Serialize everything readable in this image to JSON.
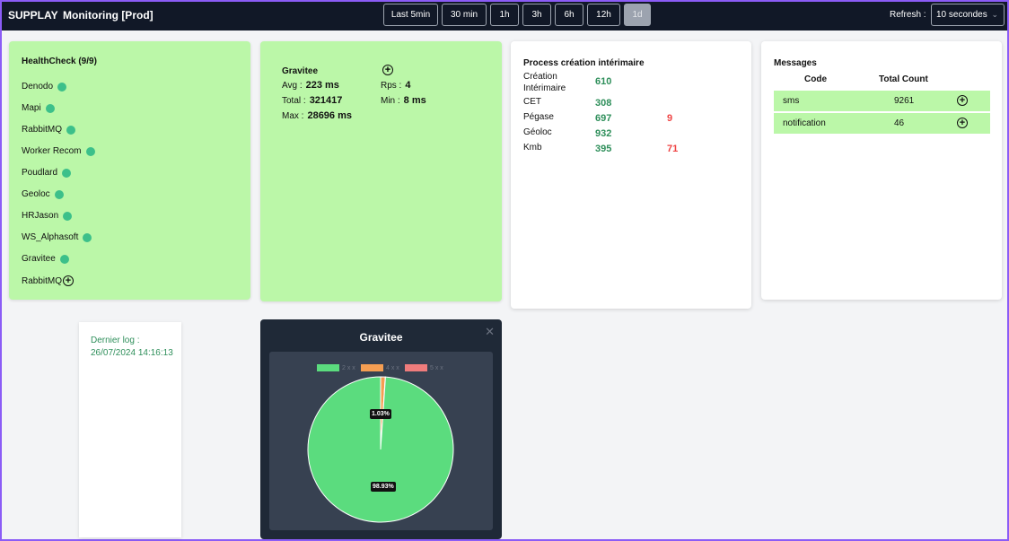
{
  "header": {
    "brand": "SUPPLAY",
    "title": "Monitoring [Prod]",
    "ranges": [
      "Last 5min",
      "30 min",
      "1h",
      "3h",
      "6h",
      "12h",
      "1d"
    ],
    "active_range": "1d",
    "refresh_label": "Refresh :",
    "refresh_value": "10 secondes"
  },
  "healthcheck": {
    "title": "HealthCheck (9/9)",
    "items": [
      {
        "name": "Denodo",
        "status": "up"
      },
      {
        "name": "Mapi",
        "status": "up"
      },
      {
        "name": "RabbitMQ",
        "status": "up"
      },
      {
        "name": "Worker Recom",
        "status": "up"
      },
      {
        "name": "Poudlard",
        "status": "up"
      },
      {
        "name": "Geoloc",
        "status": "up"
      },
      {
        "name": "HRJason",
        "status": "up"
      },
      {
        "name": "WS_Alphasoft",
        "status": "up"
      },
      {
        "name": "Gravitee",
        "status": "up"
      },
      {
        "name": "RabbitMQ",
        "status": "expand"
      }
    ],
    "status_color": "#3cc08a"
  },
  "gravitee_stats": {
    "title": "Gravitee",
    "avg_label": "Avg :",
    "avg": "223 ms",
    "total_label": "Total :",
    "total": "321417",
    "max_label": "Max :",
    "max": "28696 ms",
    "rps_label": "Rps :",
    "rps": "4",
    "min_label": "Min :",
    "min": "8 ms"
  },
  "process": {
    "title": "Process création intérimaire",
    "rows": [
      {
        "label": "Création Intérimaire",
        "value": "610",
        "errors": ""
      },
      {
        "label": "CET",
        "value": "308",
        "errors": ""
      },
      {
        "label": "Pégase",
        "value": "697",
        "errors": "9"
      },
      {
        "label": "Géoloc",
        "value": "932",
        "errors": ""
      },
      {
        "label": "Kmb",
        "value": "395",
        "errors": "71"
      }
    ]
  },
  "messages": {
    "title": "Messages",
    "col_code": "Code",
    "col_count": "Total Count",
    "rows": [
      {
        "code": "sms",
        "count": "9261"
      },
      {
        "code": "notification",
        "count": "46"
      }
    ]
  },
  "last_log": {
    "label": "Dernier log :",
    "timestamp": "26/07/2024 14:16:13"
  },
  "pie_panel": {
    "title": "Gravitee",
    "close_icon": "close-icon",
    "chart_data": {
      "type": "pie",
      "title": "Gravitee",
      "series": [
        {
          "name": "2 x x",
          "value": 98.93,
          "color": "#5bdc7e"
        },
        {
          "name": "4 x x",
          "value": 1.03,
          "color": "#f59e52"
        },
        {
          "name": "5 x x",
          "value": 0.04,
          "color": "#ef7c7c"
        }
      ],
      "labels": [
        "1.03%",
        "98.93%"
      ],
      "legend": "top"
    }
  }
}
